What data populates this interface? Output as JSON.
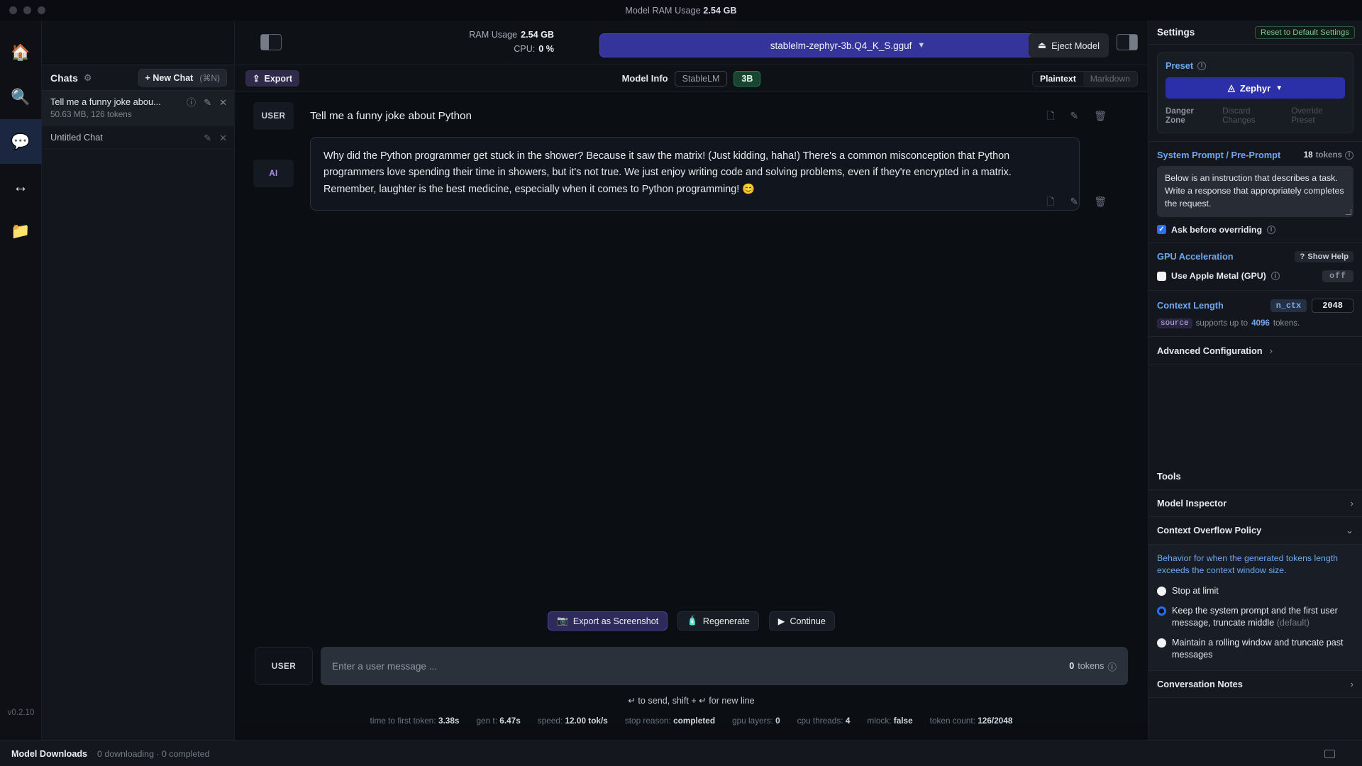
{
  "titlebar": {
    "label": "Model RAM Usage",
    "value": "2.54 GB"
  },
  "rail": {
    "items": [
      {
        "name": "home",
        "glyph": "🏠",
        "active": false
      },
      {
        "name": "search",
        "glyph": "🔍",
        "active": false
      },
      {
        "name": "chat",
        "glyph": "💬",
        "active": true
      },
      {
        "name": "server",
        "glyph": "↔",
        "active": false
      },
      {
        "name": "folder",
        "glyph": "📁",
        "active": false
      }
    ],
    "version": "v0.2.10"
  },
  "chats": {
    "title": "Chats",
    "new_chat_label": "+ New Chat",
    "new_chat_shortcut": "(⌘N)",
    "items": [
      {
        "title": "Tell me a funny joke abou...",
        "meta": "50.63 MB, 126 tokens",
        "selected": true
      },
      {
        "title": "Untitled Chat",
        "meta": "",
        "selected": false
      }
    ]
  },
  "topbar": {
    "ram_label": "RAM Usage",
    "ram_value": "2.54 GB",
    "cpu_label": "CPU:",
    "cpu_value": "0 %",
    "model_name": "stablelm-zephyr-3b.Q4_K_S.gguf",
    "eject_label": "Eject Model"
  },
  "chat_header": {
    "export_label": "Export",
    "model_info_label": "Model Info",
    "arch_tag": "StableLM",
    "size_tag": "3B",
    "format_plain": "Plaintext",
    "format_markdown": "Markdown"
  },
  "conversation": [
    {
      "role": "USER",
      "text": "Tell me a funny joke about Python"
    },
    {
      "role": "AI",
      "text": "Why did the Python programmer get stuck in the shower? Because it saw the matrix! (Just kidding, haha!) There's a common misconception that Python programmers love spending their time in showers, but it's not true. We just enjoy writing code and solving problems, even if they're encrypted in a matrix. Remember, laughter is the best medicine, especially when it comes to Python programming! 😊"
    }
  ],
  "actions": {
    "export_screenshot": "Export as Screenshot",
    "regenerate": "Regenerate",
    "continue": "Continue"
  },
  "input": {
    "role_badge": "USER",
    "placeholder": "Enter a user message ...",
    "token_count": "0",
    "token_label": "tokens",
    "hint": "↵ to send, shift + ↵ for new line"
  },
  "stats": [
    {
      "label": "time to first token:",
      "value": "3.38s"
    },
    {
      "label": "gen t:",
      "value": "6.47s"
    },
    {
      "label": "speed:",
      "value": "12.00 tok/s"
    },
    {
      "label": "stop reason:",
      "value": "completed"
    },
    {
      "label": "gpu layers:",
      "value": "0"
    },
    {
      "label": "cpu threads:",
      "value": "4"
    },
    {
      "label": "mlock:",
      "value": "false"
    },
    {
      "label": "token count:",
      "value": "126/2048"
    }
  ],
  "settings": {
    "title": "Settings",
    "reset_label": "Reset to Default Settings",
    "preset": {
      "label": "Preset",
      "value": "Zephyr",
      "danger_zone": "Danger Zone",
      "discard": "Discard Changes",
      "override": "Override Preset"
    },
    "system_prompt": {
      "label": "System Prompt / Pre-Prompt",
      "tokens": "18",
      "tokens_label": "tokens",
      "value": "Below is an instruction that describes a task. Write a response that appropriately completes the request.",
      "ask_before_overriding": "Ask before overriding"
    },
    "gpu": {
      "label": "GPU Acceleration",
      "show_help": "Show Help",
      "metal_label": "Use Apple Metal (GPU)",
      "state": "off"
    },
    "context": {
      "label": "Context Length",
      "param": "n_ctx",
      "value": "2048",
      "source_tag": "source",
      "source_text_a": "supports up to",
      "source_max": "4096",
      "source_text_b": "tokens."
    },
    "advanced_label": "Advanced Configuration",
    "tools_label": "Tools",
    "model_inspector": "Model Inspector",
    "context_overflow": "Context Overflow Policy",
    "overflow_desc": "Behavior for when the generated tokens length exceeds the context window size.",
    "overflow_options": [
      {
        "label": "Stop at limit",
        "suffix": "",
        "selected": false
      },
      {
        "label": "Keep the system prompt and the first user message, truncate middle",
        "suffix": "(default)",
        "selected": true
      },
      {
        "label": "Maintain a rolling window and truncate past messages",
        "suffix": "",
        "selected": false
      }
    ],
    "conversation_notes": "Conversation Notes"
  },
  "bottombar": {
    "title": "Model Downloads",
    "status": "0 downloading · 0 completed"
  }
}
